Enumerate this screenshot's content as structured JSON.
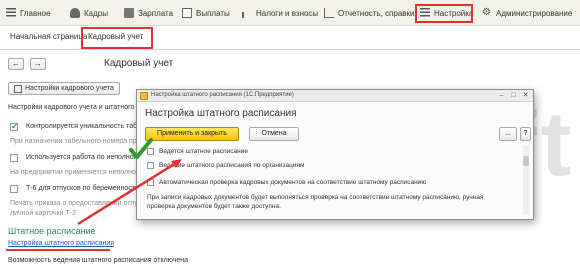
{
  "top_menu": [
    {
      "label": "Главное",
      "icon": "menu-lines-icon"
    },
    {
      "label": "Кадры",
      "icon": "people-icon"
    },
    {
      "label": "Зарплата",
      "icon": "folder-icon"
    },
    {
      "label": "Выплаты",
      "icon": "document-icon"
    },
    {
      "label": "Налоги и взносы",
      "icon": "bar-chart-icon"
    },
    {
      "label": "Отчетность, справки",
      "icon": "report-chart-icon"
    },
    {
      "label": "Настройка",
      "icon": "settings-icon",
      "highlighted": true
    },
    {
      "label": "Администрирование",
      "icon": "gear-icon"
    }
  ],
  "tabs": [
    {
      "label": "Начальная страница"
    },
    {
      "label": "Кадровый учет",
      "active": true
    }
  ],
  "nav": {
    "back": "←",
    "forward": "→"
  },
  "page": {
    "title": "Кадровый учет",
    "settings_button": "Настройки кадрового учета",
    "line1": "Настройки кадрового учета и штатного ра",
    "check1_label": "Контролируется уникальность табе",
    "check1_hint": "При назначении табельного номера прове",
    "check2_label": "Используется работа по неполной",
    "check2_hint": "На предприятии применяется неполное",
    "check3_label": "Т-6 для отпусков по беременности",
    "check3_hint_a": "Печать приказа о предоставлении отпуска",
    "check3_hint_b": "личной карточки Т-2",
    "section_heading": "Штатное расписание",
    "link": "Настройка штатного расписания",
    "status": "Возможность ведения штатного расписания отключена"
  },
  "watermark": "buhsoft.ru",
  "dialog": {
    "window_title": "Настройка штатного расписания  (1С:Предприятие)",
    "heading": "Настройка штатного расписания",
    "apply_button": "Применить и закрыть",
    "cancel_button": "Отмена",
    "more_button": "...",
    "help_button": "?",
    "opt1": "Ведется штатное расписание",
    "opt2": "Ведение штатного расписания по организациям",
    "opt3": "Автоматическая проверка кадровых документов на соответствие штатному расписанию",
    "opt3_hint_a": "При записи кадровых документов будет выполняться проверка на соответствие штатному расписанию, ручная",
    "opt3_hint_b": "проверка документов будет также доступна."
  },
  "colors": {
    "accent_red": "#e53030",
    "apply_yellow": "#f5c400",
    "section_green": "#2e8b57",
    "link_blue": "#1a5fb4",
    "check_green": "#2c9c2c"
  }
}
